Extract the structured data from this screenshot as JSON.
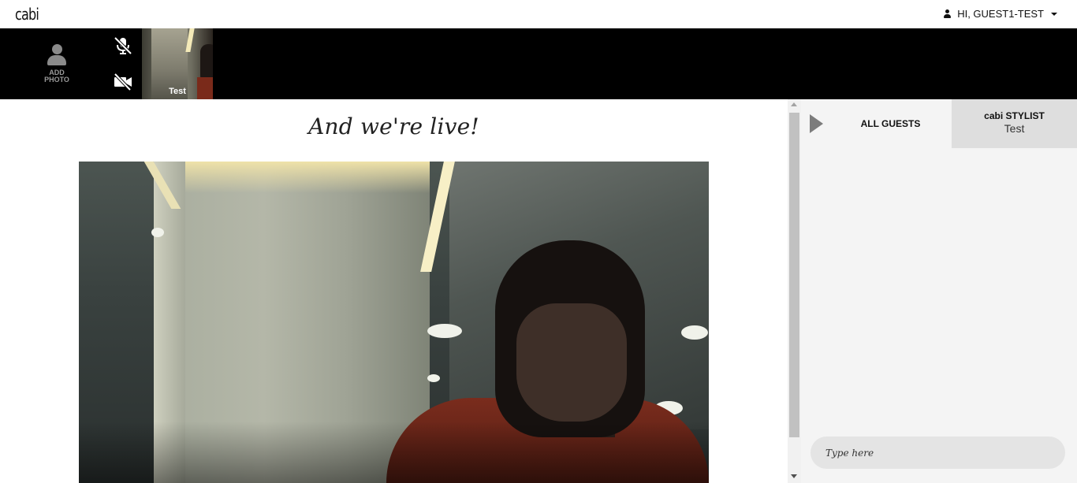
{
  "header": {
    "logo_text": "cabi",
    "user_greeting": "HI, GUEST1-TEST"
  },
  "participants_bar": {
    "add_photo_label": "ADD PHOTO",
    "self_thumbnail_label": "Test",
    "mic_state": "muted",
    "camera_state": "off"
  },
  "stage": {
    "title": "And we're live!"
  },
  "chat": {
    "tab_all_label": "ALL GUESTS",
    "tab_stylist_title": "cabi STYLIST",
    "tab_stylist_name": "Test",
    "input_placeholder": "Type here"
  },
  "colors": {
    "bar_background": "#000000",
    "chat_background": "#f4f4f4",
    "stylist_tab_background": "#dedede"
  }
}
